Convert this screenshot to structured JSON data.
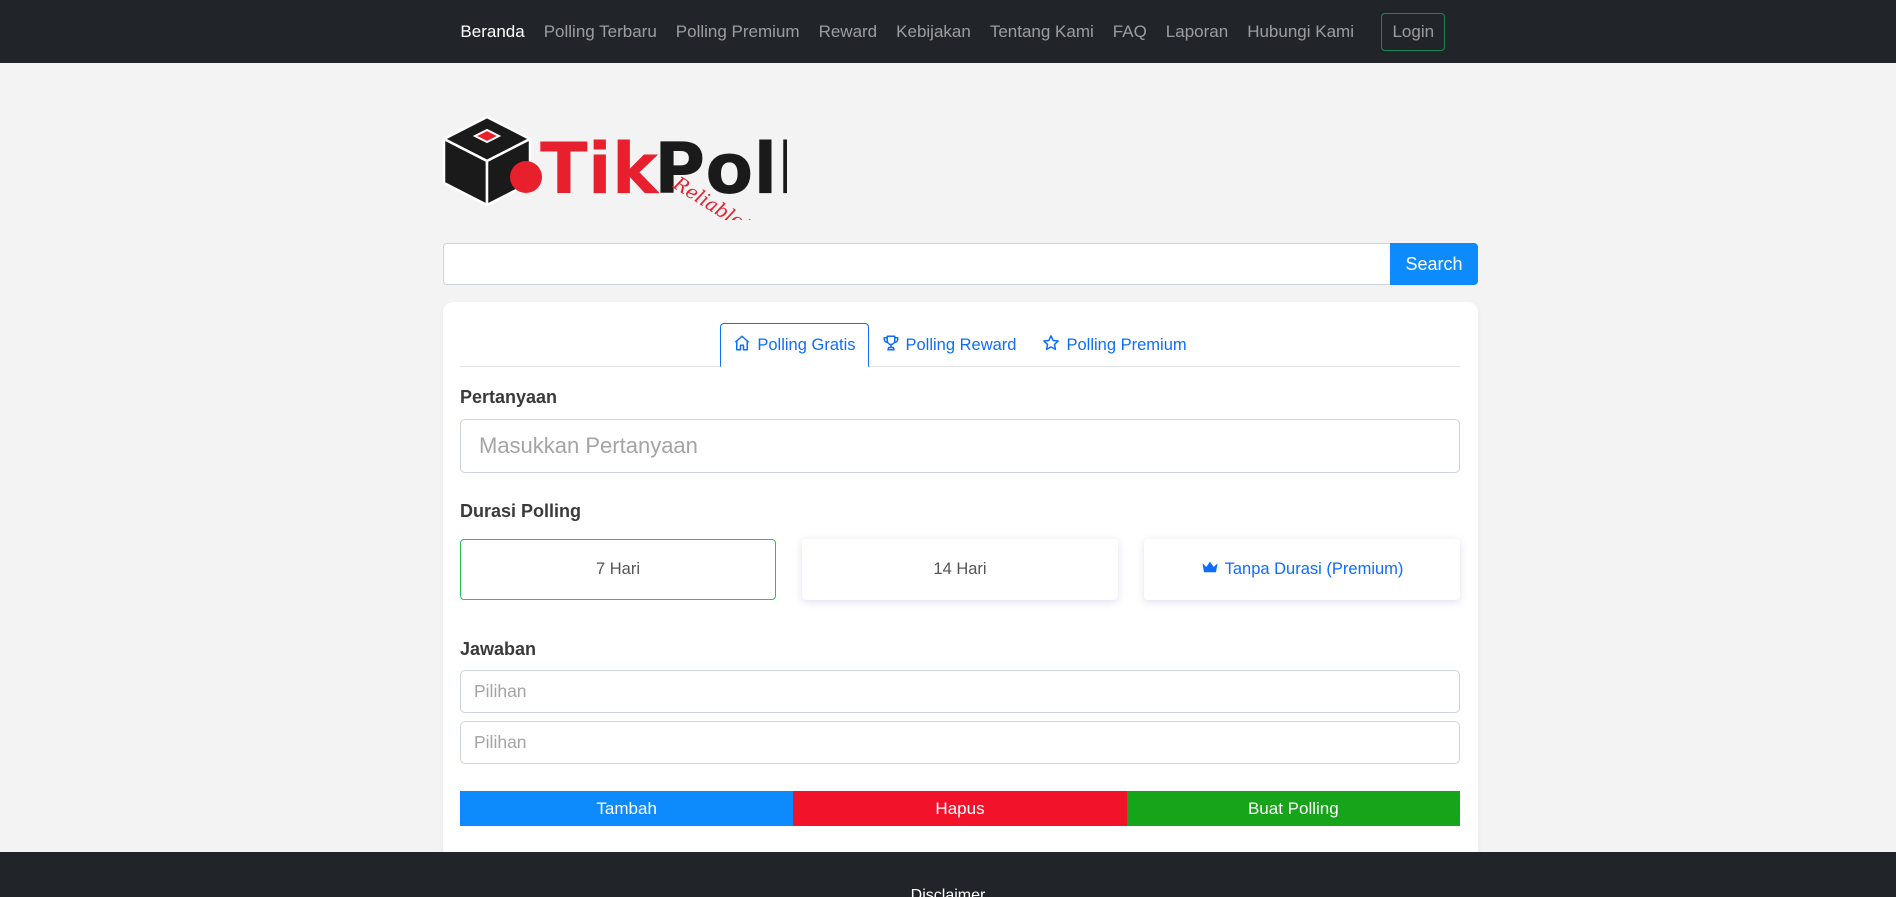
{
  "nav": {
    "items": [
      {
        "label": "Beranda",
        "active": true
      },
      {
        "label": "Polling Terbaru",
        "active": false
      },
      {
        "label": "Polling Premium",
        "active": false
      },
      {
        "label": "Reward",
        "active": false
      },
      {
        "label": "Kebijakan",
        "active": false
      },
      {
        "label": "Tentang Kami",
        "active": false
      },
      {
        "label": "FAQ",
        "active": false
      },
      {
        "label": "Laporan",
        "active": false
      },
      {
        "label": "Hubungi Kami",
        "active": false
      }
    ],
    "login_label": "Login"
  },
  "logo": {
    "brand_part1": "Tik",
    "brand_part2": "Poll",
    "tagline": "Reliable!"
  },
  "search": {
    "value": "",
    "button_label": "Search"
  },
  "tabs": [
    {
      "label": "Polling Gratis",
      "icon": "home-icon",
      "active": true
    },
    {
      "label": "Polling Reward",
      "icon": "trophy-icon",
      "active": false
    },
    {
      "label": "Polling Premium",
      "icon": "star-icon",
      "active": false
    }
  ],
  "form": {
    "question_label": "Pertanyaan",
    "question_placeholder": "Masukkan Pertanyaan",
    "duration_label": "Durasi Polling",
    "durations": [
      {
        "label": "7 Hari",
        "selected": true
      },
      {
        "label": "14 Hari",
        "selected": false
      },
      {
        "label": "Tanpa Durasi (Premium)",
        "selected": false,
        "icon": "crown-icon"
      }
    ],
    "answer_label": "Jawaban",
    "answers": [
      {
        "placeholder": "Pilihan"
      },
      {
        "placeholder": "Pilihan"
      }
    ],
    "add_label": "Tambah",
    "delete_label": "Hapus",
    "create_label": "Buat Polling"
  },
  "footer": {
    "title": "Disclaimer"
  },
  "colors": {
    "navbar_bg": "#212529",
    "primary": "#0d8bfd",
    "danger": "#f21229",
    "success": "#17a31a",
    "logo_red": "#e8202e"
  }
}
